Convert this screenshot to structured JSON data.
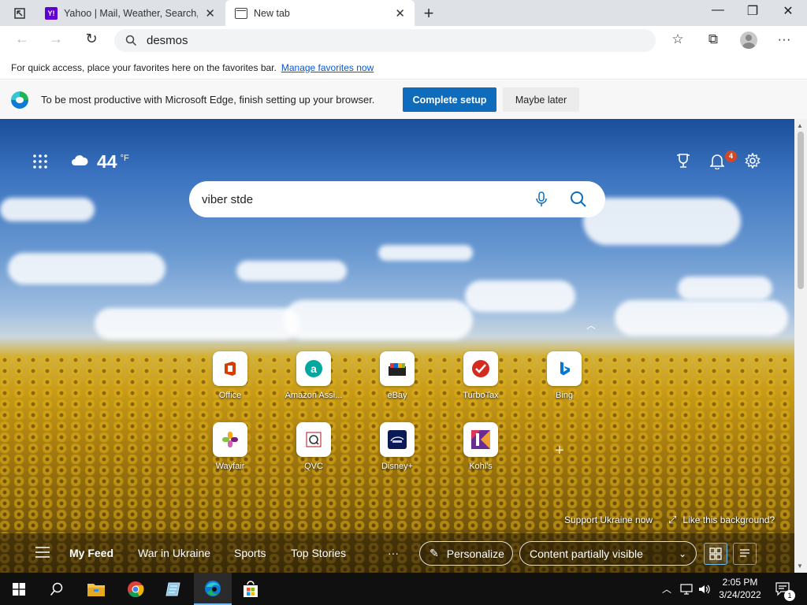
{
  "tabs": [
    {
      "label": "Yahoo | Mail, Weather, Search, Politics, News, Finance, Sports & Videos",
      "favicon": "Y!"
    },
    {
      "label": "New tab"
    }
  ],
  "address": {
    "value": "desmos"
  },
  "favorites_bar": {
    "text": "For quick access, place your favorites here on the favorites bar.",
    "link": "Manage favorites now"
  },
  "setup_bar": {
    "text": "To be most productive with Microsoft Edge, finish setting up your browser.",
    "primary": "Complete setup",
    "secondary": "Maybe later"
  },
  "weather": {
    "temp": "44",
    "unit": "°F"
  },
  "notifications": {
    "count": "4"
  },
  "search": {
    "value": "viber stde"
  },
  "quick_links": [
    {
      "label": "Office",
      "color": "#d83b01"
    },
    {
      "label": "Amazon Assi...",
      "color": "#00a8a0"
    },
    {
      "label": "eBay",
      "color": "#e53238"
    },
    {
      "label": "TurboTax",
      "color": "#d52b1e"
    },
    {
      "label": "Bing",
      "color": "#0078d4"
    },
    {
      "label": "Wayfair",
      "color": "#7f187f"
    },
    {
      "label": "QVC",
      "color": "#b5121b"
    },
    {
      "label": "Disney+",
      "color": "#113ccf"
    },
    {
      "label": "Kohl's",
      "color": "#6b2c91"
    }
  ],
  "background": {
    "support": "Support Ukraine now",
    "like": "Like this background?"
  },
  "feed": {
    "items": [
      "My Feed",
      "War in Ukraine",
      "Sports",
      "Top Stories"
    ],
    "more": "···",
    "personalize": "Personalize",
    "visibility": "Content partially visible"
  },
  "clock": {
    "time": "2:05 PM",
    "date": "3/24/2022"
  },
  "tray": {
    "notification_count": "1"
  }
}
